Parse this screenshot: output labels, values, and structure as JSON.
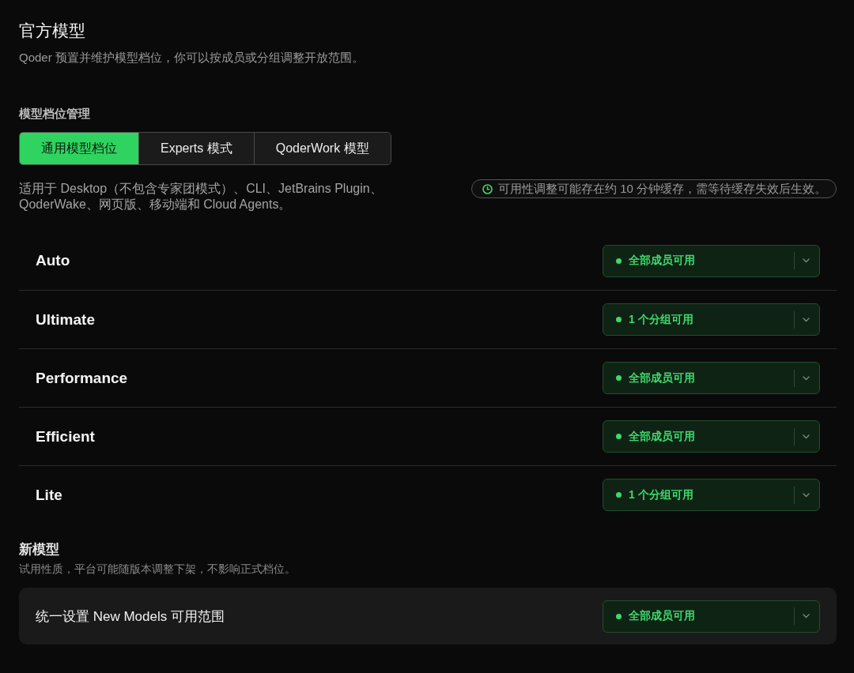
{
  "header": {
    "title": "官方模型",
    "subtitle": "Qoder 预置并维护模型档位，你可以按成员或分组调整开放范围。"
  },
  "tier_management": {
    "label": "模型档位管理",
    "tabs": [
      {
        "label": "通用模型档位",
        "selected": true
      },
      {
        "label": "Experts 模式",
        "selected": false
      },
      {
        "label": "QoderWork 模型",
        "selected": false
      }
    ],
    "description": "适用于 Desktop（不包含专家团模式）、CLI、JetBrains Plugin、QoderWake、网页版、移动端和 Cloud Agents。",
    "notice": "可用性调整可能存在约 10 分钟缓存，需等待缓存失效后生效。"
  },
  "tiers": [
    {
      "name": "Auto",
      "availability": "全部成员可用"
    },
    {
      "name": "Ultimate",
      "availability": "1 个分组可用"
    },
    {
      "name": "Performance",
      "availability": "全部成员可用"
    },
    {
      "name": "Efficient",
      "availability": "全部成员可用"
    },
    {
      "name": "Lite",
      "availability": "1 个分组可用"
    }
  ],
  "new_models": {
    "title": "新模型",
    "subtitle": "试用性质，平台可能随版本调整下架，不影响正式档位。",
    "setting": {
      "label": "统一设置 New Models 可用范围",
      "availability": "全部成员可用"
    }
  }
}
